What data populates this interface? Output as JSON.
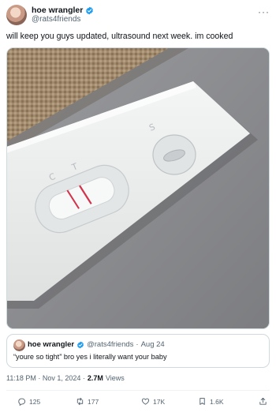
{
  "author": {
    "display_name": "hoe wrangler",
    "handle": "@rats4friends"
  },
  "tweet": {
    "text": "will keep you guys updated, ultrasound next week. im cooked"
  },
  "quoted_tweet": {
    "display_name": "hoe wrangler",
    "handle": "@rats4friends",
    "separator": "·",
    "date": "Aug 24",
    "text": "“youre so tight” bro yes i literally want your baby"
  },
  "meta": {
    "timestamp": "11:18 PM · Nov 1, 2024 ·",
    "views_count": "2.7M",
    "views_label": "Views"
  },
  "actions": {
    "replies": "125",
    "reposts": "177",
    "likes": "17K",
    "bookmarks": "1.6K"
  },
  "icons": {
    "verified": "verified-badge-icon",
    "more": "more-icon",
    "reply": "reply-icon",
    "repost": "repost-icon",
    "like": "heart-icon",
    "bookmark": "bookmark-icon",
    "share": "share-icon"
  },
  "colors": {
    "verified": "#1d9bf0",
    "text": "#0f1419",
    "secondary": "#536471",
    "border": "#cfd9de",
    "test_line": "#d2324a"
  }
}
